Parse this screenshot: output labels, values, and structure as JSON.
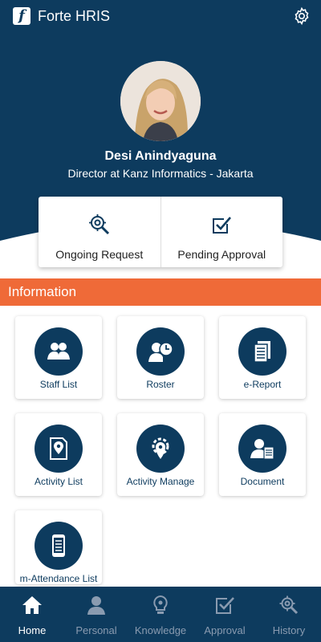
{
  "app": {
    "title": "Forte HRIS",
    "logo_letter": "f"
  },
  "profile": {
    "name": "Desi Anindyaguna",
    "role": "Director at Kanz Informatics - Jakarta"
  },
  "actions": [
    {
      "label": "Ongoing Request",
      "icon": "search-gear-icon"
    },
    {
      "label": "Pending Approval",
      "icon": "checkbox-icon"
    }
  ],
  "section": {
    "title": "Information"
  },
  "menu": [
    {
      "label": "Staff List",
      "icon": "users-icon"
    },
    {
      "label": "Roster",
      "icon": "user-clock-icon"
    },
    {
      "label": "e-Report",
      "icon": "report-icon"
    },
    {
      "label": "Activity List",
      "icon": "map-pin-document-icon"
    },
    {
      "label": "Activity Manage",
      "icon": "pin-gear-icon"
    },
    {
      "label": "Document",
      "icon": "user-document-icon"
    },
    {
      "label": "m-Attendance List",
      "icon": "mobile-list-icon"
    }
  ],
  "nav": [
    {
      "label": "Home",
      "icon": "home-icon",
      "active": true
    },
    {
      "label": "Personal",
      "icon": "person-icon",
      "active": false
    },
    {
      "label": "Knowledge",
      "icon": "lightbulb-icon",
      "active": false
    },
    {
      "label": "Approval",
      "icon": "checkbox-icon",
      "active": false
    },
    {
      "label": "History",
      "icon": "search-gear-icon",
      "active": false
    }
  ],
  "colors": {
    "primary": "#0d3b5e",
    "accent": "#ef6a38",
    "nav_inactive": "#8a9bb0"
  }
}
